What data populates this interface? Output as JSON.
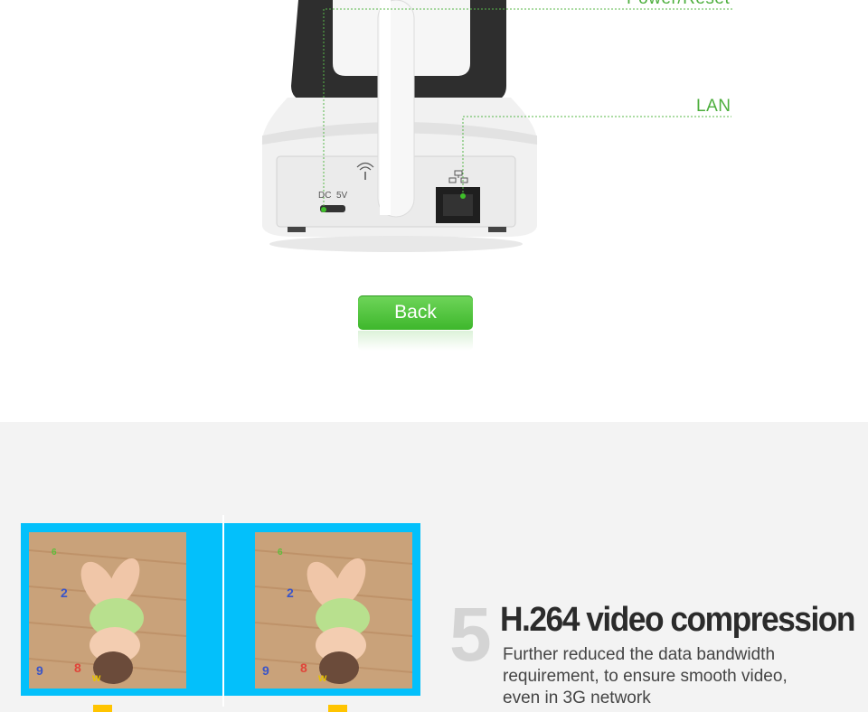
{
  "callouts": {
    "power_reset": "Power/Reset",
    "lan": "LAN"
  },
  "camera_ports": {
    "dc_label": "DC  5V"
  },
  "back_button": {
    "label": "Back"
  },
  "feature": {
    "number": "5",
    "title": "H.264 video compression",
    "description_lines": [
      "Further reduced the data bandwidth",
      "requirement, to ensure smooth video,",
      "even in 3G network"
    ]
  },
  "colors": {
    "callout_green": "#4cae3c",
    "button_green": "#45bb32",
    "frame_blue": "#03c0fb",
    "tab_yellow": "#ffc400",
    "lower_bg": "#f3f3f3"
  }
}
